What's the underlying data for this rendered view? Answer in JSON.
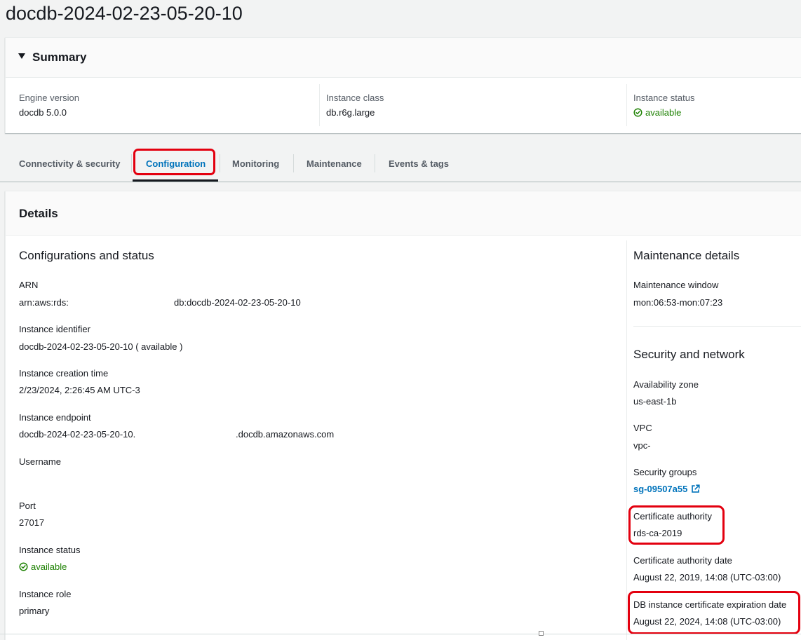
{
  "page": {
    "title": "docdb-2024-02-23-05-20-10"
  },
  "summary": {
    "title": "Summary",
    "engine_version": {
      "label": "Engine version",
      "value": "docdb 5.0.0"
    },
    "instance_class": {
      "label": "Instance class",
      "value": "db.r6g.large"
    },
    "instance_status": {
      "label": "Instance status",
      "value": "available"
    }
  },
  "tabs": [
    {
      "label": "Connectivity & security"
    },
    {
      "label": "Configuration"
    },
    {
      "label": "Monitoring"
    },
    {
      "label": "Maintenance"
    },
    {
      "label": "Events & tags"
    }
  ],
  "active_tab": "Configuration",
  "details": {
    "title": "Details",
    "config": {
      "heading": "Configurations and status",
      "arn": {
        "label": "ARN",
        "value_prefix": "arn:aws:rds:",
        "value_suffix": "db:docdb-2024-02-23-05-20-10"
      },
      "identifier": {
        "label": "Instance identifier",
        "value": "docdb-2024-02-23-05-20-10 ( available )"
      },
      "creation_time": {
        "label": "Instance creation time",
        "value": "2/23/2024, 2:26:45 AM UTC-3"
      },
      "endpoint": {
        "label": "Instance endpoint",
        "value_prefix": "docdb-2024-02-23-05-20-10.",
        "value_suffix": ".docdb.amazonaws.com"
      },
      "username": {
        "label": "Username",
        "value": ""
      },
      "port": {
        "label": "Port",
        "value": "27017"
      },
      "status": {
        "label": "Instance status",
        "value": "available"
      },
      "role": {
        "label": "Instance role",
        "value": "primary"
      }
    },
    "maintenance": {
      "heading": "Maintenance details",
      "window": {
        "label": "Maintenance window",
        "value": "mon:06:53-mon:07:23"
      }
    },
    "security": {
      "heading": "Security and network",
      "az": {
        "label": "Availability zone",
        "value": "us-east-1b"
      },
      "vpc": {
        "label": "VPC",
        "value": "vpc-"
      },
      "security_groups": {
        "label": "Security groups",
        "value": "sg-09507a55"
      },
      "ca": {
        "label": "Certificate authority",
        "value": "rds-ca-2019"
      },
      "ca_date": {
        "label": "Certificate authority date",
        "value": "August 22, 2019, 14:08 (UTC-03:00)"
      },
      "cert_expiration": {
        "label": "DB instance certificate expiration date",
        "value": "August 22, 2024, 14:08 (UTC-03:00)"
      }
    }
  },
  "colors": {
    "link": "#0073bb",
    "success": "#1d8102",
    "highlight": "#e3000f"
  },
  "icons": {
    "status": "check-circle-icon",
    "external": "external-link-icon",
    "summary_toggle": "caret-down-icon"
  }
}
